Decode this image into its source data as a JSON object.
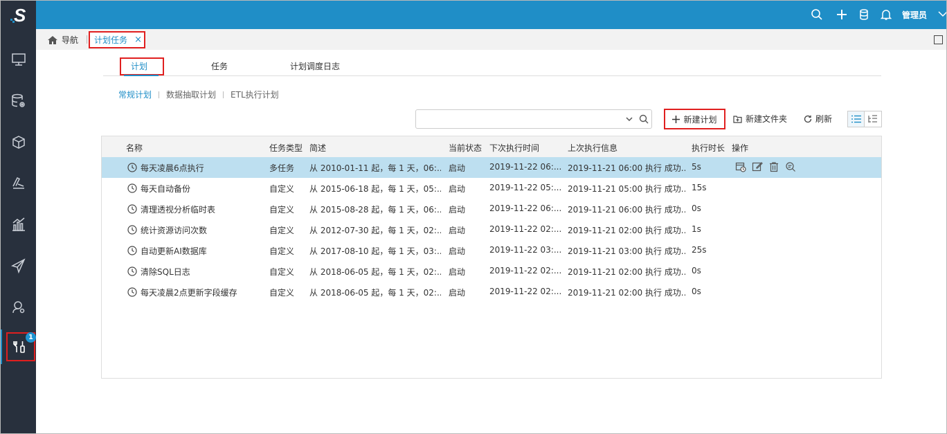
{
  "app": {
    "logo_letter": "S",
    "admin_label": "管理员",
    "top_icons": [
      "search-icon",
      "plus-icon",
      "database-icon",
      "bell-icon"
    ]
  },
  "tabs": {
    "home_label": "导航",
    "active_tab": "计划任务",
    "close_glyph": "×"
  },
  "sidebar": {
    "items": [
      "monitor-icon",
      "data-settings-icon",
      "cube-icon",
      "ruler-icon",
      "chart-icon",
      "send-icon",
      "user-settings-icon",
      "tools-icon"
    ],
    "badge": "1"
  },
  "subtabs": [
    {
      "label": "计划"
    },
    {
      "label": "任务"
    },
    {
      "label": "计划调度日志"
    }
  ],
  "categories": [
    {
      "label": "常规计划"
    },
    {
      "label": "数据抽取计划"
    },
    {
      "label": "ETL执行计划"
    }
  ],
  "toolbar": {
    "search_value": "",
    "new_plan": "新建计划",
    "new_folder": "新建文件夹",
    "refresh": "刷新"
  },
  "table": {
    "headers": [
      "名称",
      "任务类型",
      "简述",
      "当前状态",
      "下次执行时间",
      "上次执行信息",
      "执行时长",
      "操作"
    ],
    "rows": [
      {
        "name": "每天凌晨6点执行",
        "type": "多任务",
        "desc": "从 2010-01-11 起，每 1 天，06:...",
        "status": "启动",
        "next": "2019-11-22 06:...",
        "last": "2019-11-21 06:00 执行 成功...",
        "duration": "5s"
      },
      {
        "name": "每天自动备份",
        "type": "自定义",
        "desc": "从 2015-06-18 起，每 1 天，05:...",
        "status": "启动",
        "next": "2019-11-22 05:...",
        "last": "2019-11-21 05:00 执行 成功...",
        "duration": "15s"
      },
      {
        "name": "清理透视分析临时表",
        "type": "自定义",
        "desc": "从 2015-08-28 起，每 1 天，06:...",
        "status": "启动",
        "next": "2019-11-22 06:...",
        "last": "2019-11-21 06:00 执行 成功...",
        "duration": "0s"
      },
      {
        "name": "统计资源访问次数",
        "type": "自定义",
        "desc": "从 2012-07-30 起，每 1 天，02:...",
        "status": "启动",
        "next": "2019-11-22 02:...",
        "last": "2019-11-21 02:00 执行 成功...",
        "duration": "1s"
      },
      {
        "name": "自动更新AI数据库",
        "type": "自定义",
        "desc": "从 2017-08-10 起，每 1 天，03:...",
        "status": "启动",
        "next": "2019-11-22 03:...",
        "last": "2019-11-21 03:00 执行 成功...",
        "duration": "25s"
      },
      {
        "name": "清除SQL日志",
        "type": "自定义",
        "desc": "从 2018-06-05 起，每 1 天，02:...",
        "status": "启动",
        "next": "2019-11-22 02:...",
        "last": "2019-11-21 02:00 执行 成功...",
        "duration": "0s"
      },
      {
        "name": "每天凌晨2点更新字段缓存",
        "type": "自定义",
        "desc": "从 2018-06-05 起，每 1 天，02:...",
        "status": "启动",
        "next": "2019-11-22 02:...",
        "last": "2019-11-21 02:00 执行 成功...",
        "duration": "0s"
      }
    ],
    "row_actions": [
      "schedule-run-icon",
      "edit-icon",
      "delete-icon",
      "view-log-icon"
    ]
  },
  "colors": {
    "accent": "#1f8ec7",
    "sidebar": "#28303d",
    "selected_row": "#bddff0",
    "highlight_border": "#e01f1f"
  }
}
